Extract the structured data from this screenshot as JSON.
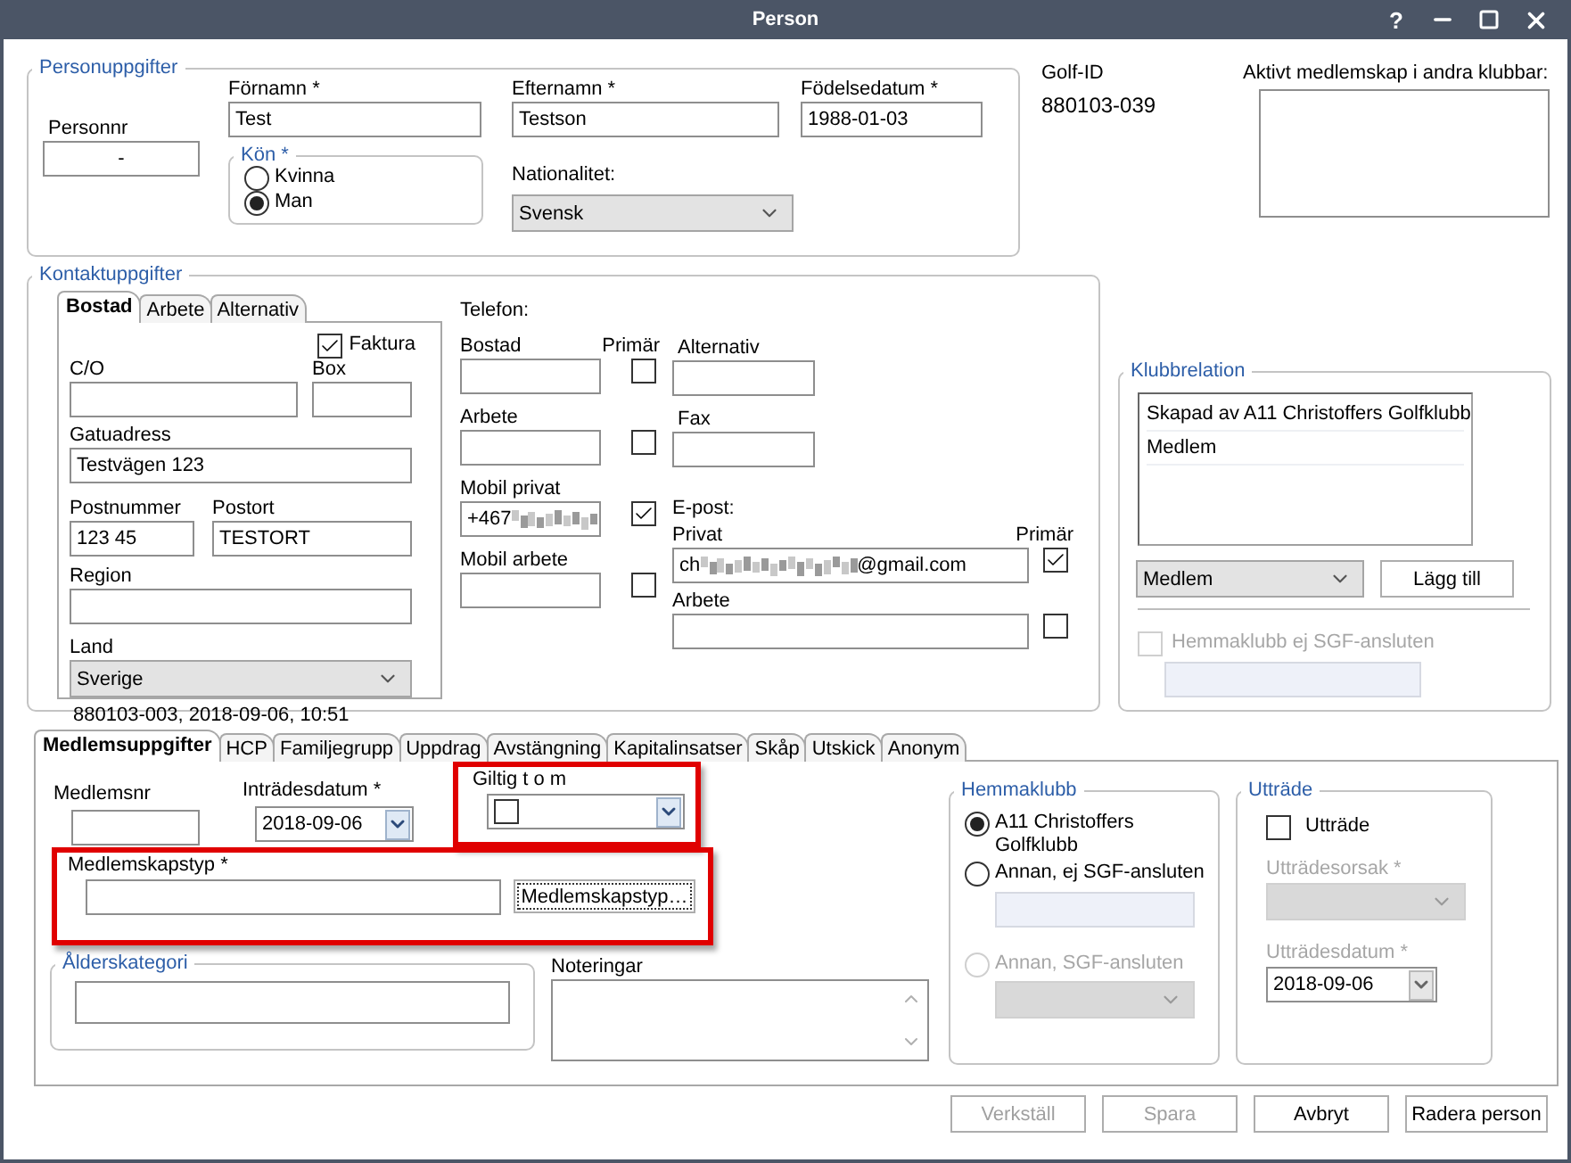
{
  "window": {
    "title": "Person",
    "help": "?"
  },
  "person": {
    "legend": "Personuppgifter",
    "personnr": {
      "label": "Personnr",
      "value": "-"
    },
    "fornamn": {
      "label": "Förnamn *",
      "value": "Test"
    },
    "efternamn": {
      "label": "Efternamn *",
      "value": "Testson"
    },
    "fodelsedatum": {
      "label": "Födelsedatum *",
      "value": "1988-01-03"
    },
    "kon": {
      "legend": "Kön *",
      "options": [
        {
          "label": "Kvinna",
          "selected": false
        },
        {
          "label": "Man",
          "selected": true
        }
      ]
    },
    "nationalitet": {
      "label": "Nationalitet:",
      "value": "Svensk"
    }
  },
  "golf_id": {
    "label": "Golf-ID",
    "value": "880103-039"
  },
  "other_clubs": {
    "label": "Aktivt medlemskap i andra klubbar:"
  },
  "contact": {
    "legend": "Kontaktuppgifter",
    "tabs": [
      {
        "label": "Bostad",
        "selected": true
      },
      {
        "label": "Arbete",
        "selected": false
      },
      {
        "label": "Alternativ",
        "selected": false
      }
    ],
    "faktura": {
      "label": "Faktura",
      "checked": true
    },
    "co": {
      "label": "C/O"
    },
    "box": {
      "label": "Box"
    },
    "gatuadress": {
      "label": "Gatuadress",
      "value": "Testvägen 123"
    },
    "postnummer": {
      "label": "Postnummer",
      "value": "123 45"
    },
    "postort": {
      "label": "Postort",
      "value": "TESTORT"
    },
    "region": {
      "label": "Region"
    },
    "land": {
      "label": "Land",
      "value": "Sverige"
    },
    "footer": "880103-003, 2018-09-06, 10:51",
    "telefon": {
      "label": "Telefon:",
      "primary_label": "Primär",
      "fields": [
        {
          "label": "Bostad",
          "primary": false
        },
        {
          "label": "Arbete",
          "primary": false
        },
        {
          "label": "Mobil privat",
          "value": "+467",
          "redacted": true,
          "primary": true
        },
        {
          "label": "Mobil arbete",
          "primary": false
        }
      ],
      "extra": [
        {
          "label": "Alternativ"
        },
        {
          "label": "Fax"
        }
      ]
    },
    "epost": {
      "label": "E-post:",
      "primary_label": "Primär",
      "fields": [
        {
          "label": "Privat",
          "value": "ch",
          "redacted": true,
          "value_end": "@gmail.com",
          "primary": true
        },
        {
          "label": "Arbete",
          "primary": false
        }
      ]
    }
  },
  "klubbrelation": {
    "legend": "Klubbrelation",
    "items": [
      "Skapad av A11 Christoffers Golfklubb",
      "Medlem"
    ],
    "select": "Medlem",
    "add_button": "Lägg till",
    "hemmaklubb": {
      "label": "Hemmaklubb ej SGF-ansluten",
      "checked": false,
      "disabled": true
    }
  },
  "member_tabs": [
    {
      "label": "Medlemsuppgifter",
      "selected": true
    },
    {
      "label": "HCP",
      "selected": false
    },
    {
      "label": "Familjegrupp",
      "selected": false
    },
    {
      "label": "Uppdrag",
      "selected": false
    },
    {
      "label": "Avstängning",
      "selected": false
    },
    {
      "label": "Kapitalinsatser",
      "selected": false
    },
    {
      "label": "Skåp",
      "selected": false
    },
    {
      "label": "Utskick",
      "selected": false
    },
    {
      "label": "Anonym",
      "selected": false
    }
  ],
  "member": {
    "medlemsnr": {
      "label": "Medlemsnr"
    },
    "intradesdatum": {
      "label": "Inträdesdatum *",
      "value": "2018-09-06"
    },
    "giltig": {
      "label": "Giltig t o m",
      "checked": false,
      "highlighted": true
    },
    "medlemskapstyp": {
      "label": "Medlemskapstyp *",
      "button": "Medlemskapstyp…",
      "highlighted": true
    },
    "alderskategori": {
      "legend": "Ålderskategori"
    },
    "noteringar": {
      "label": "Noteringar"
    },
    "hemmaklubb": {
      "legend": "Hemmaklubb",
      "options": [
        {
          "label": "A11 Christoffers Golfklubb",
          "selected": true,
          "disabled": false
        },
        {
          "label": "Annan, ej SGF-ansluten",
          "selected": false,
          "disabled": false
        },
        {
          "label": "Annan, SGF-ansluten",
          "selected": false,
          "disabled": true
        }
      ]
    },
    "uttrade": {
      "legend": "Utträde",
      "checkbox": {
        "label": "Utträde",
        "checked": false
      },
      "orsak": {
        "label": "Utträdesorsak *",
        "disabled": true
      },
      "datum": {
        "label": "Utträdesdatum *",
        "value": "2018-09-06",
        "disabled": true
      }
    }
  },
  "buttons": [
    {
      "label": "Verkställ",
      "disabled": true
    },
    {
      "label": "Spara",
      "disabled": true
    },
    {
      "label": "Avbryt",
      "disabled": false
    },
    {
      "label": "Radera person",
      "disabled": false
    }
  ]
}
